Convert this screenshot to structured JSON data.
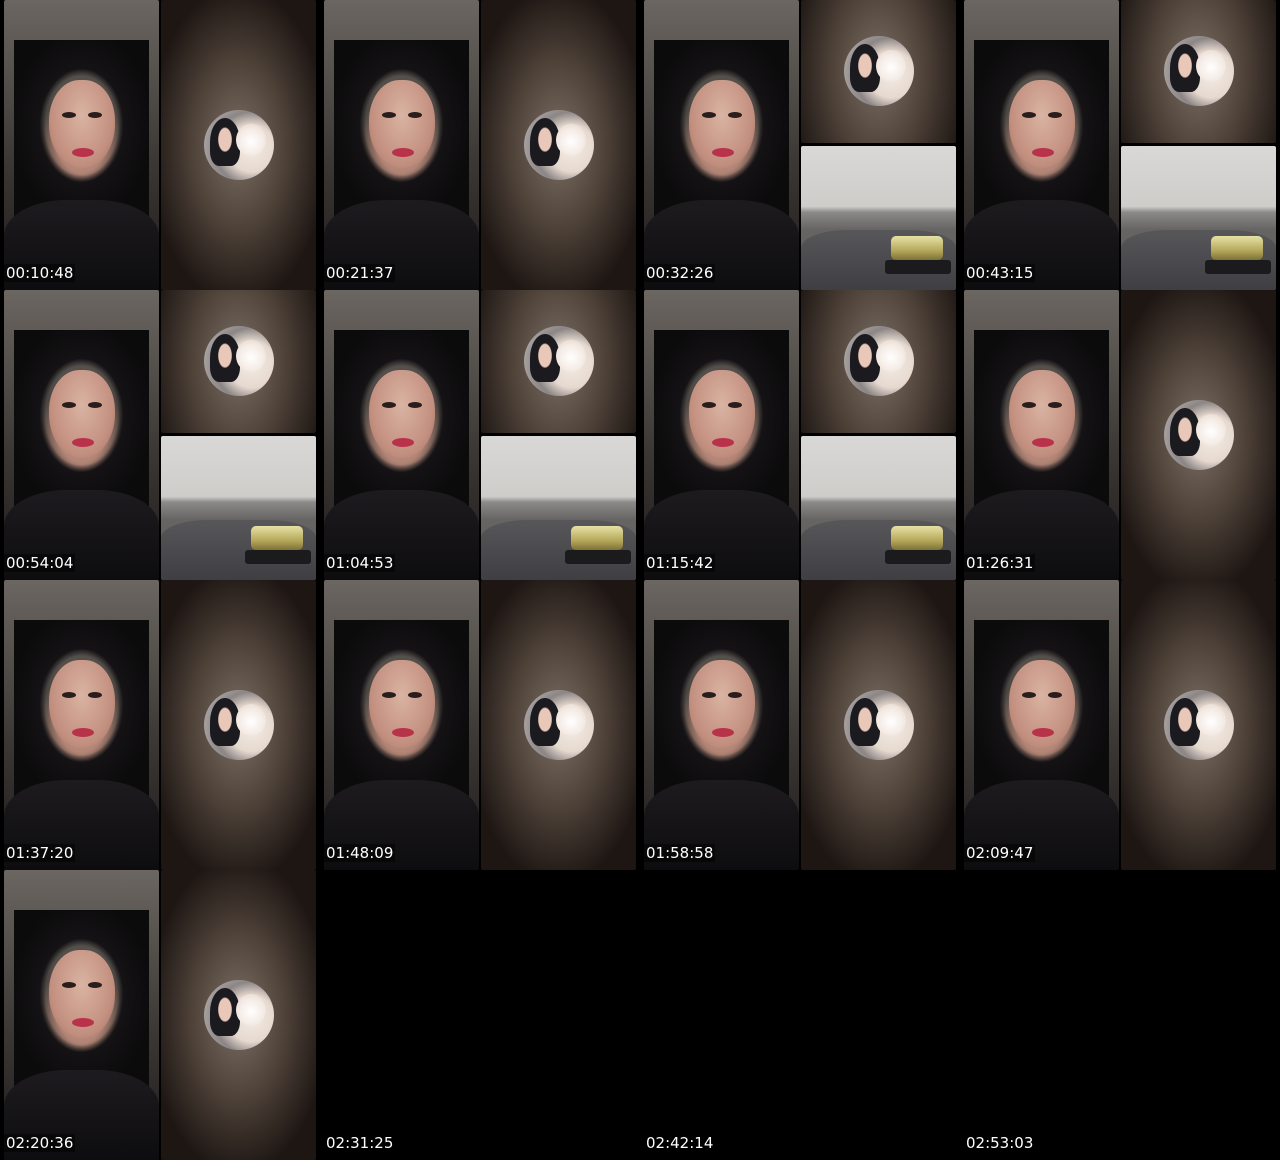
{
  "timestamps": [
    "00:10:48",
    "00:21:37",
    "00:32:26",
    "00:43:15",
    "00:54:04",
    "01:04:53",
    "01:15:42",
    "01:26:31",
    "01:37:20",
    "01:48:09",
    "01:58:58",
    "02:09:47",
    "02:20:36",
    "02:31:25",
    "02:42:14",
    "02:53:03"
  ],
  "tiles": [
    {
      "person": true,
      "right": "avatar"
    },
    {
      "person": true,
      "right": "avatar"
    },
    {
      "person": true,
      "right": "avatar-over-road"
    },
    {
      "person": true,
      "right": "avatar-over-road"
    },
    {
      "person": true,
      "right": "avatar-over-road"
    },
    {
      "person": true,
      "right": "avatar-over-road"
    },
    {
      "person": true,
      "right": "avatar-over-road"
    },
    {
      "person": true,
      "right": "avatar-full"
    },
    {
      "person": true,
      "right": "avatar"
    },
    {
      "person": true,
      "right": "avatar"
    },
    {
      "person": true,
      "right": "avatar"
    },
    {
      "person": true,
      "right": "avatar"
    },
    {
      "person": true,
      "right": "avatar"
    },
    {
      "person": false,
      "right": "none"
    },
    {
      "person": false,
      "right": "none"
    },
    {
      "person": false,
      "right": "none"
    }
  ]
}
